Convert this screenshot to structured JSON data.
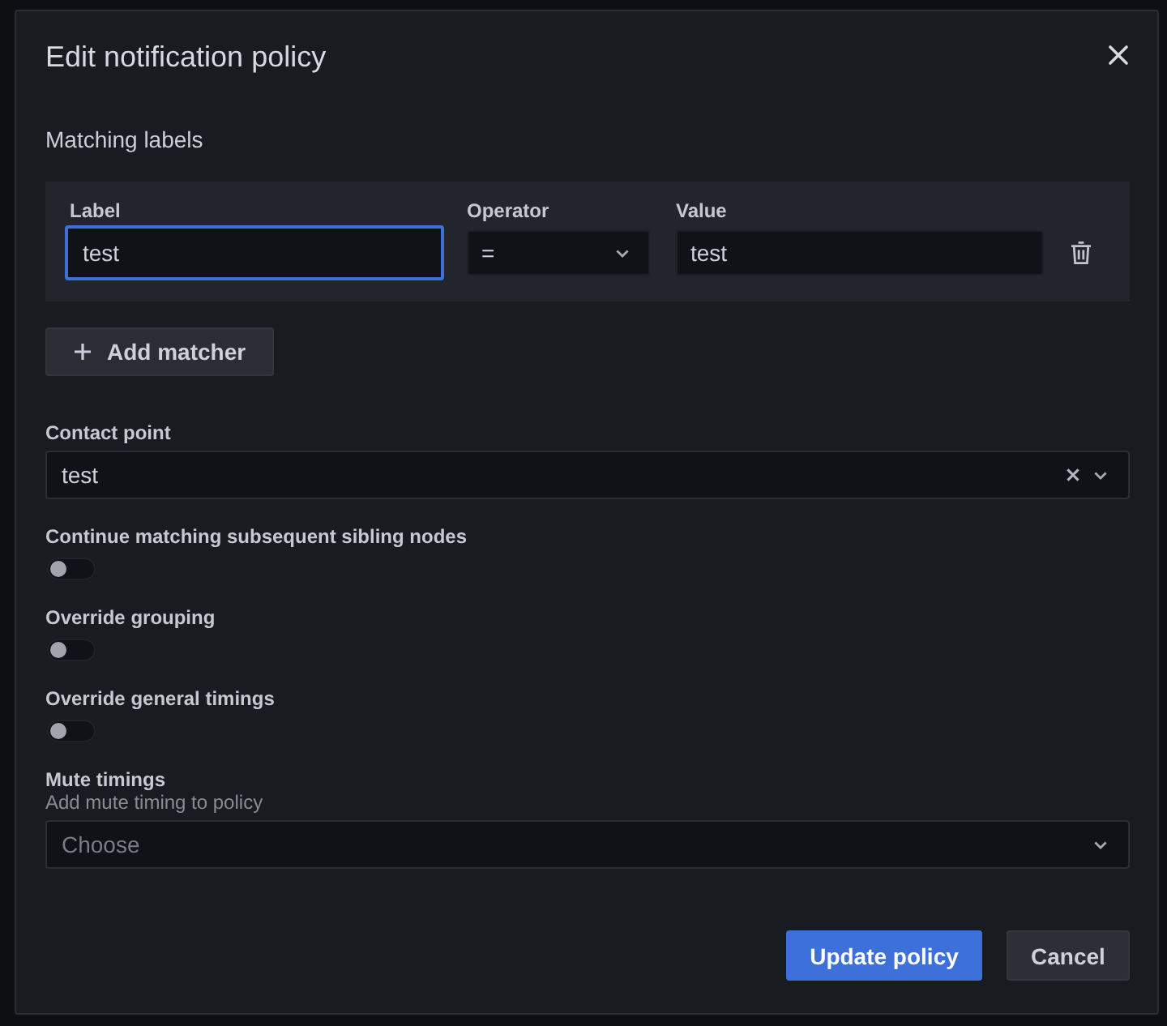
{
  "dialog": {
    "title": "Edit notification policy"
  },
  "matching_labels": {
    "heading": "Matching labels",
    "columns": [
      "Label",
      "Operator",
      "Value"
    ],
    "matchers": [
      {
        "label": "test",
        "label_focused": true,
        "operator": "=",
        "value": "test"
      }
    ],
    "add_button": "Add matcher"
  },
  "contact_point": {
    "label": "Contact point",
    "value": "test"
  },
  "toggles": [
    {
      "label": "Continue matching subsequent sibling nodes",
      "on": false
    },
    {
      "label": "Override grouping",
      "on": false
    },
    {
      "label": "Override general timings",
      "on": false
    }
  ],
  "mute_timings": {
    "label": "Mute timings",
    "description": "Add mute timing to policy",
    "placeholder": "Choose"
  },
  "buttons": [
    {
      "label": "Update policy",
      "kind": "primary"
    },
    {
      "label": "Cancel",
      "kind": "secondary"
    }
  ]
}
